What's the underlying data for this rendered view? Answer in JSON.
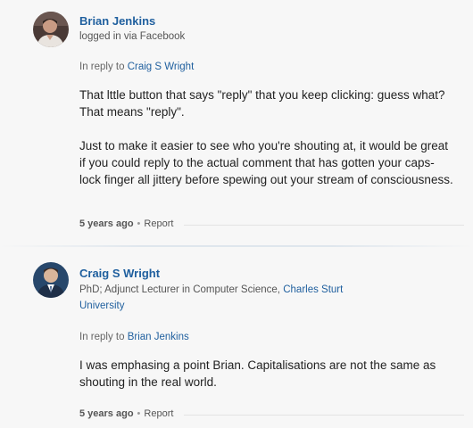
{
  "comments": [
    {
      "author": "Brian Jenkins",
      "meta_text": "logged in via Facebook",
      "in_reply_prefix": "In reply to",
      "in_reply_name": "Craig S Wright",
      "paragraphs": [
        "That lttle button that says \"reply\" that you keep clicking: guess what? That means \"reply\".",
        "Just to make it easier to see who you're shouting at, it would be great if you could reply to the actual comment that has gotten your caps-lock finger all jittery before spewing out your stream of consciousness."
      ],
      "time": "5 years ago",
      "separator": "•",
      "report": "Report",
      "avatar_icon": "user-avatar-photo"
    },
    {
      "author": "Craig S Wright",
      "meta_prefix": "PhD; Adjunct Lecturer in Computer Science,",
      "meta_link": "Charles Sturt University",
      "in_reply_prefix": "In reply to",
      "in_reply_name": "Brian Jenkins",
      "paragraphs": [
        "I was emphasing a point Brian. Capitalisations are not the same as shouting in the real world."
      ],
      "time": "5 years ago",
      "separator": "•",
      "report": "Report",
      "avatar_icon": "user-avatar-photo"
    }
  ],
  "colors": {
    "link": "#1f5f9e",
    "background": "#f7f7f7",
    "text": "#222222"
  }
}
